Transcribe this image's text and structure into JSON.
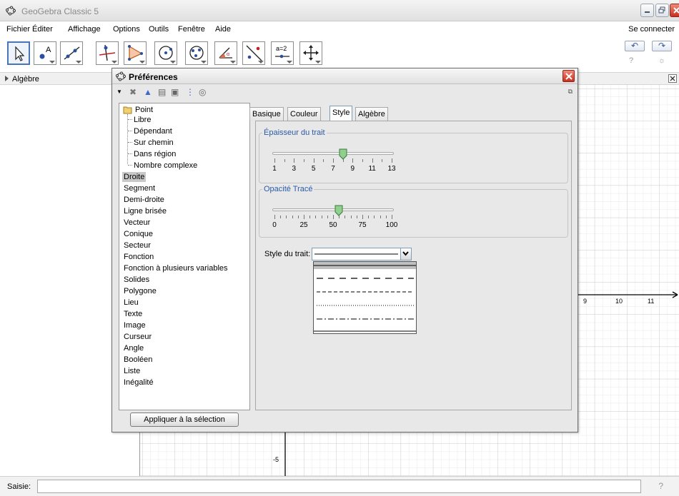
{
  "window": {
    "title": "GeoGebra Classic 5"
  },
  "menu": {
    "items": [
      "Fichier",
      "Éditer",
      "Affichage",
      "Options",
      "Outils",
      "Fenêtre",
      "Aide"
    ],
    "right": "Se connecter"
  },
  "toolbar": {
    "tools": [
      "move-tool",
      "point-tool",
      "line-tool",
      "perpendicular-tool",
      "polygon-tool",
      "circle-tool",
      "conic-tool",
      "angle-tool",
      "reflect-tool",
      "slider-tool",
      "move-graphics-tool"
    ],
    "slider_label": "a=2",
    "undo": "↶",
    "redo": "↷",
    "help_icon": "?",
    "settings_icon": "☼"
  },
  "algebra_view": {
    "label": "Algèbre"
  },
  "graphics": {
    "x_labels": [
      "9",
      "10",
      "11"
    ],
    "y_labels": [
      "-5"
    ]
  },
  "input_bar": {
    "label": "Saisie:",
    "value": ""
  },
  "dialog": {
    "title": "Préférences",
    "tree": {
      "root": "Point",
      "children": [
        "Libre",
        "Dépendant",
        "Sur chemin",
        "Dans région",
        "Nombre complexe"
      ],
      "items": [
        "Droite",
        "Segment",
        "Demi-droite",
        "Ligne brisée",
        "Vecteur",
        "Conique",
        "Secteur",
        "Fonction",
        "Fonction à plusieurs variables",
        "Solides",
        "Polygone",
        "Lieu",
        "Texte",
        "Image",
        "Curseur",
        "Angle",
        "Booléen",
        "Liste",
        "Inégalité"
      ],
      "selected": "Droite"
    },
    "tabs": [
      "Basique",
      "Couleur",
      "Style",
      "Algèbre"
    ],
    "active_tab": "Style",
    "thickness": {
      "legend": "Épaisseur du trait",
      "labels": [
        "1",
        "3",
        "5",
        "7",
        "9",
        "11",
        "13"
      ],
      "min": 1,
      "max": 13,
      "value": 8
    },
    "opacity": {
      "legend": "Opacité Tracé",
      "labels": [
        "0",
        "25",
        "50",
        "75",
        "100"
      ],
      "min": 0,
      "max": 100,
      "value": 55
    },
    "line_style": {
      "label": "Style du trait:",
      "options": [
        "solid",
        "dashed-long",
        "dashed-short",
        "dotted",
        "dash-dot",
        "solid"
      ]
    },
    "apply_button": "Appliquer à la sélection"
  },
  "colors": {
    "accent": "#2a5aa8",
    "selected_tool": "#4a74b8",
    "close_red": "#c83020"
  }
}
